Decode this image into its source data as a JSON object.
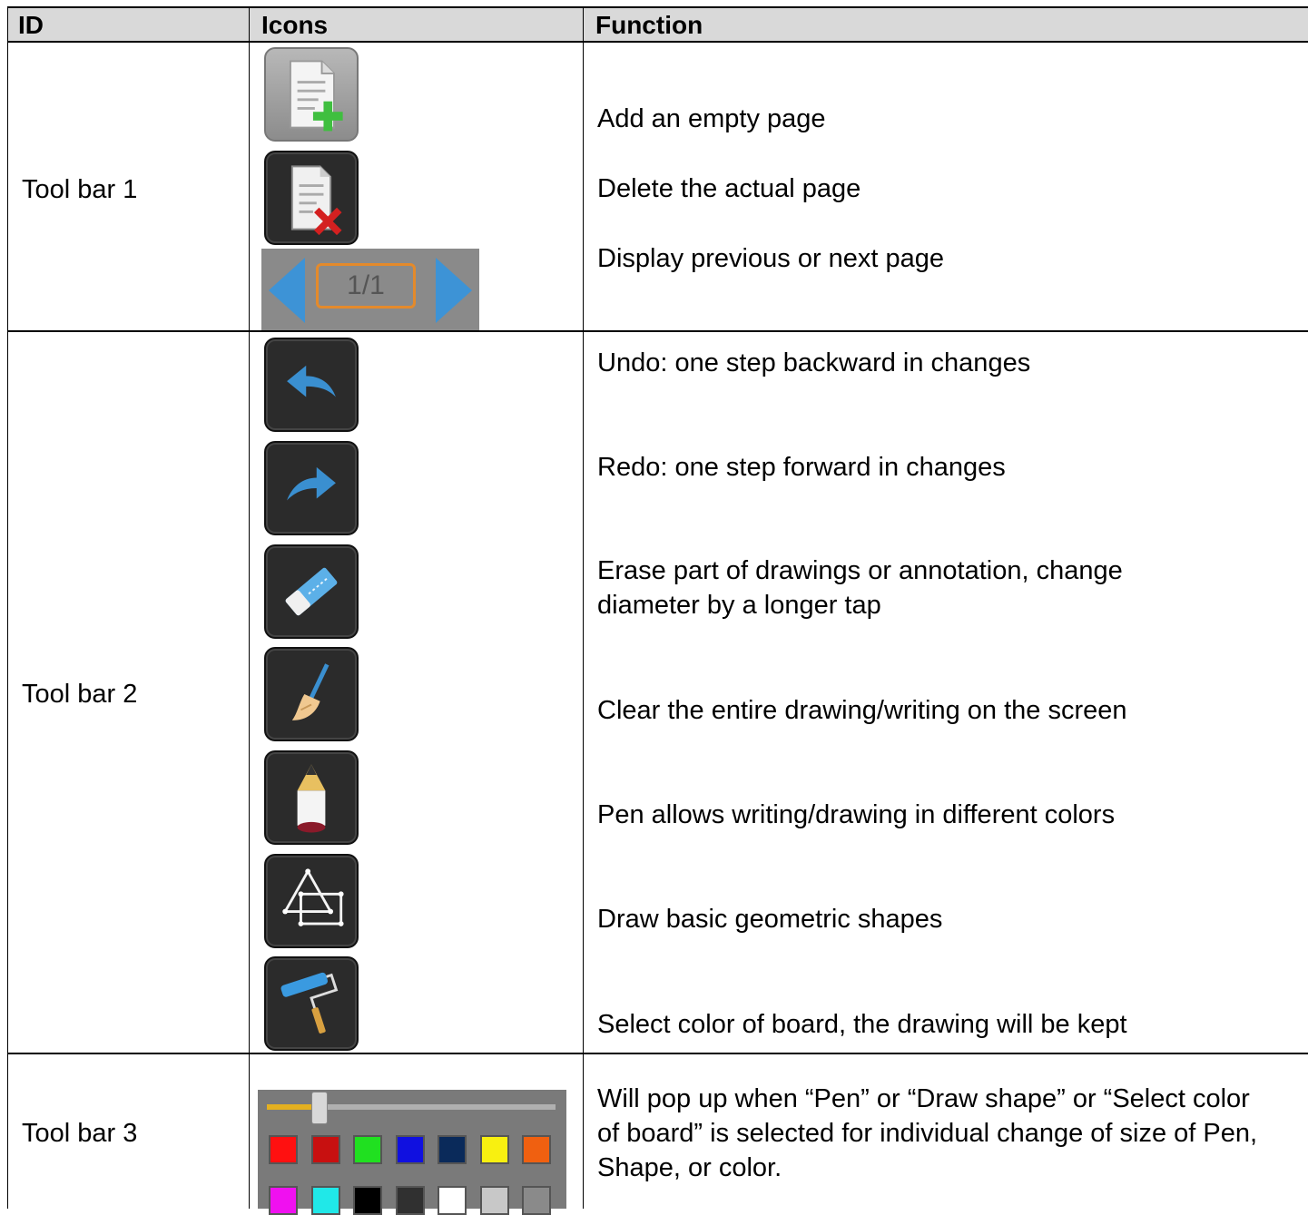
{
  "header": {
    "id": "ID",
    "icons": "Icons",
    "function": "Function"
  },
  "rows": [
    {
      "id": "Tool bar 1",
      "functions": [
        "Add an empty page",
        "Delete the actual page",
        "Display previous or next page"
      ],
      "icons": [
        "add-page-icon",
        "delete-page-icon",
        "page-navigation-icon"
      ],
      "page_indicator": "1/1"
    },
    {
      "id": "Tool bar 2",
      "functions": [
        "Undo: one step backward in changes",
        "Redo: one step forward in changes",
        "Erase part of drawings or annotation, change diameter by a longer tap",
        "Clear the entire drawing/writing on the screen",
        "Pen allows writing/drawing in different colors",
        "Draw basic geometric shapes",
        "Select color of board, the drawing will be kept"
      ],
      "icons": [
        "undo-icon",
        "redo-icon",
        "eraser-icon",
        "broom-icon",
        "pen-icon",
        "shapes-icon",
        "paint-roller-icon"
      ]
    },
    {
      "id": "Tool bar 3",
      "functions": [
        "Will pop up when “Pen” or “Draw shape” or “Select color of board” is selected for individual change of size of Pen, Shape, or color."
      ],
      "icons": [
        "size-slider-and-color-palette"
      ],
      "slider_level": 0.18,
      "palette_row1": [
        "#ff1010",
        "#c81010",
        "#20e020",
        "#1010e0",
        "#0a2a5a",
        "#f8f010",
        "#f06010"
      ],
      "palette_row2": [
        "#f010f0",
        "#20e8e8",
        "#000000",
        "#303030",
        "#ffffff",
        "#c8c8c8",
        "#8a8a8a"
      ]
    }
  ]
}
